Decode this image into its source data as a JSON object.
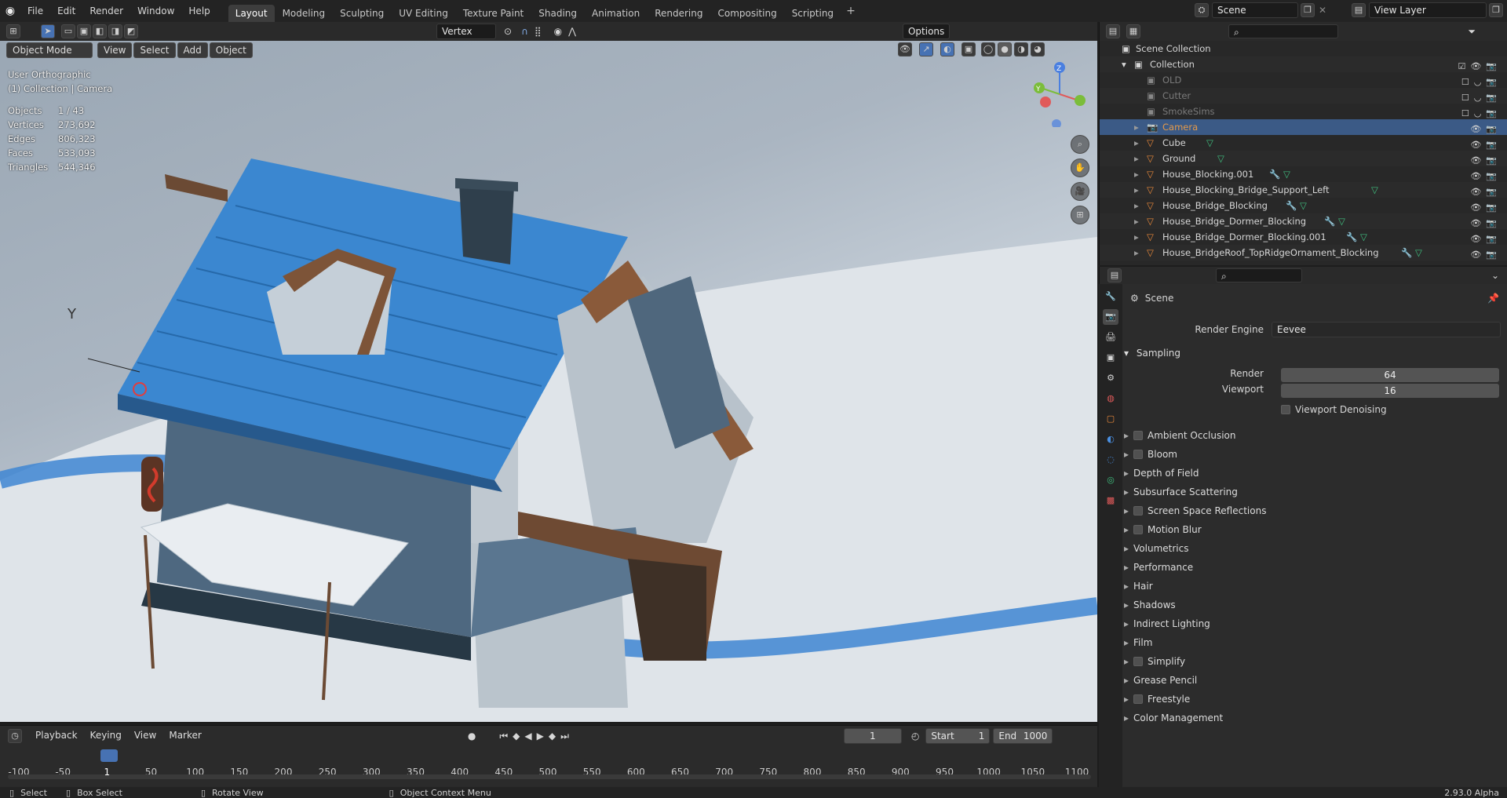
{
  "topbar": {
    "menus": [
      "File",
      "Edit",
      "Render",
      "Window",
      "Help"
    ],
    "workspaces": [
      "Layout",
      "Modeling",
      "Sculpting",
      "UV Editing",
      "Texture Paint",
      "Shading",
      "Animation",
      "Rendering",
      "Compositing",
      "Scripting"
    ],
    "active_workspace": "Layout",
    "add_tab": "+",
    "scene": "Scene",
    "view_layer": "View Layer"
  },
  "viewport": {
    "mode": "Object Mode",
    "menus": [
      "View",
      "Select",
      "Add",
      "Object"
    ],
    "snap_target": "Vertex",
    "options": "Options",
    "view_name": "User Orthographic",
    "active": "(1) Collection | Camera",
    "stats": [
      {
        "label": "Objects",
        "value": "1 / 43"
      },
      {
        "label": "Vertices",
        "value": "273,692"
      },
      {
        "label": "Edges",
        "value": "806,323"
      },
      {
        "label": "Faces",
        "value": "533,093"
      },
      {
        "label": "Triangles",
        "value": "544,346"
      }
    ],
    "axis_label": "Y",
    "gizmo_axes": [
      "Z",
      "Y",
      "X"
    ]
  },
  "timeline": {
    "menus": [
      "Playback",
      "Keying",
      "View",
      "Marker"
    ],
    "current_frame": "1",
    "start_label": "Start",
    "start": "1",
    "end_label": "End",
    "end": "1000",
    "ticks": [
      "-100",
      "-50",
      "1",
      "50",
      "100",
      "150",
      "200",
      "250",
      "300",
      "350",
      "400",
      "450",
      "500",
      "550",
      "600",
      "650",
      "700",
      "750",
      "800",
      "850",
      "900",
      "950",
      "1000",
      "1050",
      "1100"
    ]
  },
  "statusbar": {
    "select": "Select",
    "box_select": "Box Select",
    "rotate": "Rotate View",
    "context": "Object Context Menu",
    "version": "2.93.0 Alpha"
  },
  "outliner": {
    "root": "Scene Collection",
    "collection": "Collection",
    "items": [
      {
        "name": "OLD",
        "type": "collection",
        "disabled": true
      },
      {
        "name": "Cutter",
        "type": "collection",
        "disabled": true
      },
      {
        "name": "SmokeSims",
        "type": "collection",
        "disabled": true
      },
      {
        "name": "Camera",
        "type": "camera",
        "selected": true
      },
      {
        "name": "Cube",
        "type": "mesh"
      },
      {
        "name": "Ground",
        "type": "mesh"
      },
      {
        "name": "House_Blocking.001",
        "type": "mesh",
        "modifier": true
      },
      {
        "name": "House_Blocking_Bridge_Support_Left",
        "type": "mesh"
      },
      {
        "name": "House_Bridge_Blocking",
        "type": "mesh",
        "modifier": true
      },
      {
        "name": "House_Bridge_Dormer_Blocking",
        "type": "mesh",
        "modifier": true
      },
      {
        "name": "House_Bridge_Dormer_Blocking.001",
        "type": "mesh",
        "modifier": true
      },
      {
        "name": "House_BridgeRoof_TopRidgeOrnament_Blocking",
        "type": "mesh",
        "modifier": true
      }
    ]
  },
  "properties": {
    "context": "Scene",
    "render_engine_label": "Render Engine",
    "render_engine": "Eevee",
    "sampling": "Sampling",
    "render_label": "Render",
    "render_samples": "64",
    "viewport_label": "Viewport",
    "viewport_samples": "16",
    "viewport_denoising": "Viewport Denoising",
    "panels": [
      {
        "name": "Ambient Occlusion",
        "checkbox": true
      },
      {
        "name": "Bloom",
        "checkbox": true
      },
      {
        "name": "Depth of Field",
        "checkbox": false
      },
      {
        "name": "Subsurface Scattering",
        "checkbox": false
      },
      {
        "name": "Screen Space Reflections",
        "checkbox": true
      },
      {
        "name": "Motion Blur",
        "checkbox": true
      },
      {
        "name": "Volumetrics",
        "checkbox": false
      },
      {
        "name": "Performance",
        "checkbox": false
      },
      {
        "name": "Hair",
        "checkbox": false
      },
      {
        "name": "Shadows",
        "checkbox": false
      },
      {
        "name": "Indirect Lighting",
        "checkbox": false
      },
      {
        "name": "Film",
        "checkbox": false
      },
      {
        "name": "Simplify",
        "checkbox": true
      },
      {
        "name": "Grease Pencil",
        "checkbox": false
      },
      {
        "name": "Freestyle",
        "checkbox": true
      },
      {
        "name": "Color Management",
        "checkbox": false
      }
    ]
  },
  "colors": {
    "accent": "#4772b3",
    "selected_row": "#3b5a86",
    "camera_orange": "#e59a4a",
    "mesh_orange": "#e8883a"
  }
}
